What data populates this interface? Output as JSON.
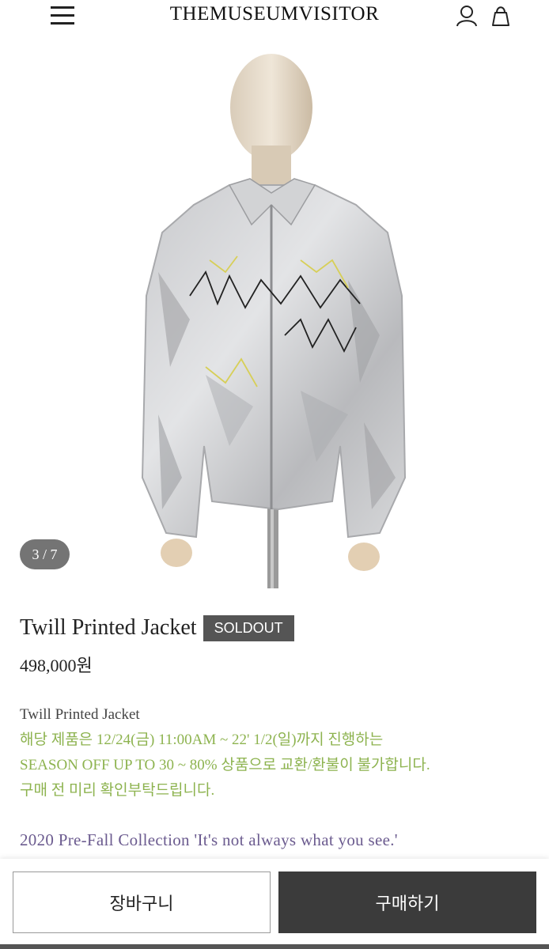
{
  "header": {
    "brand": "THEMUSEUMVISITOR",
    "icons": {
      "menu": "hamburger-icon",
      "user": "user-icon",
      "bag": "shopping-bag-icon"
    }
  },
  "gallery": {
    "counter": "3 / 7",
    "image_alt": "Twill Printed Jacket on mannequin"
  },
  "product": {
    "title": "Twill Printed Jacket",
    "badge": "SOLDOUT",
    "price": "498,000원",
    "desc_name": "Twill Printed Jacket",
    "notice_line1": "해당 제품은 12/24(금) 11:00AM ~ 22' 1/2(일)까지 진행하는",
    "notice_line2": "SEASON OFF UP TO 30 ~ 80% 상품으로 교환/환불이 불가합니다.",
    "notice_line3": "구매 전 미리 확인부탁드립니다.",
    "collection": "2020 Pre-Fall Collection 'It's not always what you see.'"
  },
  "actions": {
    "cart_label": "장바구니",
    "buy_label": "구매하기"
  },
  "colors": {
    "notice_green": "#8db34f",
    "collection_purple": "#6b5b8f",
    "buy_bg": "#3b3b3b",
    "badge_bg": "#555555"
  }
}
